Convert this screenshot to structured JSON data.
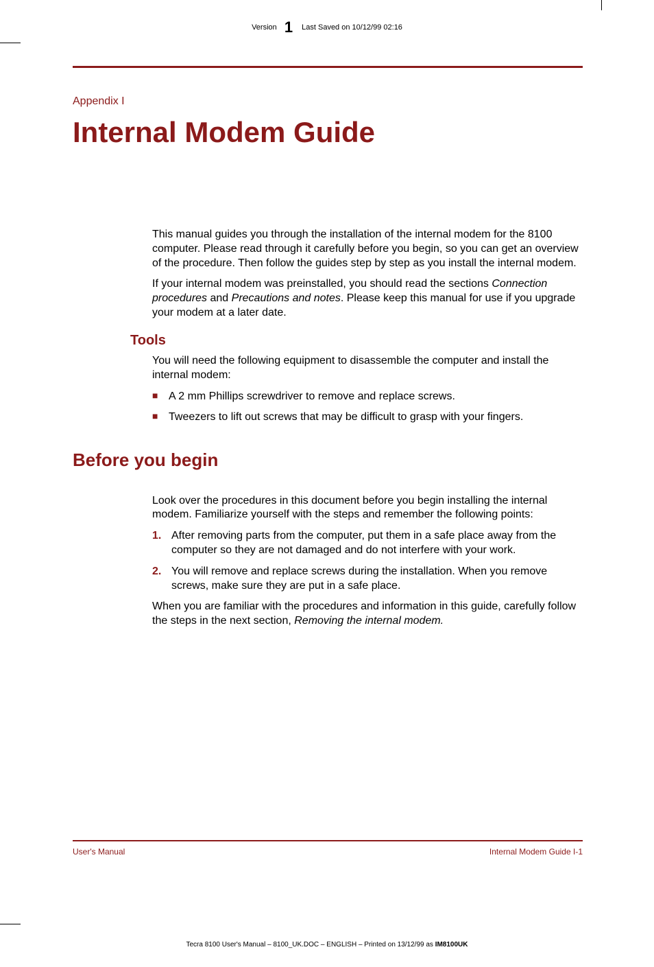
{
  "header": {
    "version_label": "Version",
    "version_number": "1",
    "saved_label": "Last Saved on 10/12/99 02:16"
  },
  "appendix_label": "Appendix I",
  "page_title": "Internal Modem Guide",
  "intro": {
    "p1": "This manual guides you through the installation of the internal modem for the 8100 computer. Please read through it carefully before you begin, so you can get an overview of the procedure. Then follow the guides step by step as you install the internal modem.",
    "p2_a": "If your internal modem was preinstalled, you should read the sections ",
    "p2_i1": "Connection procedures",
    "p2_b": " and ",
    "p2_i2": "Precautions and notes",
    "p2_c": ". Please keep this manual for use if you upgrade your modem at a later date."
  },
  "tools": {
    "heading": "Tools",
    "intro": "You will need the following equipment to disassemble the computer and install the internal modem:",
    "items": [
      "A 2 mm Phillips screwdriver to remove and replace screws.",
      "Tweezers to lift out screws that may be difficult to grasp with your fingers."
    ]
  },
  "before": {
    "heading": "Before you begin",
    "intro": "Look over the procedures in this document before you begin installing the internal modem. Familiarize yourself with the steps and remember the following points:",
    "items": [
      "After removing parts from the computer, put them in a safe place away from the computer so they are not damaged and do not interfere with your work.",
      "You will remove and replace screws during the installation. When you remove screws, make sure they are put in a safe place."
    ],
    "outro_a": "When you are familiar with the procedures and information in this guide, carefully follow the steps in the next section, ",
    "outro_i": "Removing the internal modem."
  },
  "footer": {
    "left": "User's Manual",
    "right": "Internal Modem Guide  I-1"
  },
  "bottom_meta": {
    "a": "Tecra 8100 User's Manual  – 8100_UK.DOC – ENGLISH – Printed on 13/12/99 as ",
    "b": "IM8100UK"
  }
}
